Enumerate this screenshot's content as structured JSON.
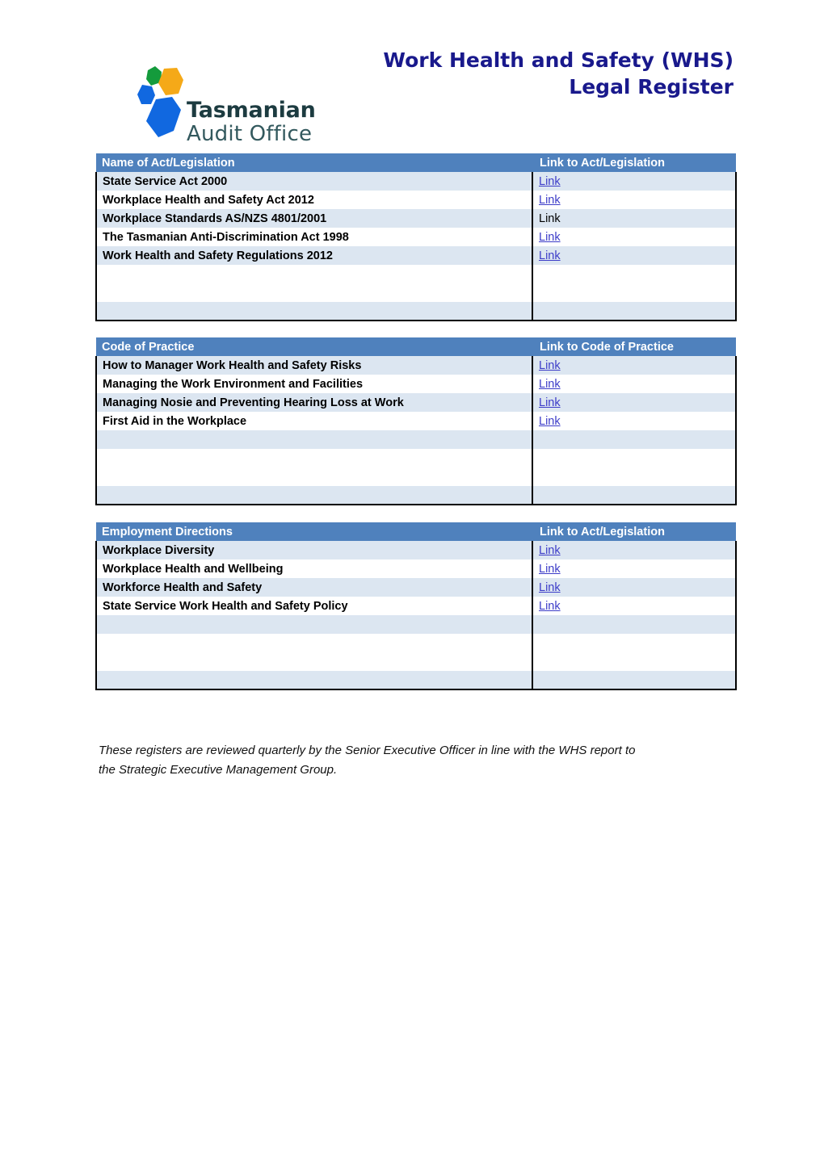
{
  "header": {
    "logo": {
      "line1": "Tasmanian",
      "line2": "Audit Office",
      "colors": {
        "green": "#149b3c",
        "orange": "#f5a918",
        "blue": "#1168e0",
        "wordmark_dark": "#1c3b40",
        "wordmark_light": "#33595e"
      }
    },
    "title_line1": "Work Health and Safety (WHS)",
    "title_line2": "Legal Register",
    "title_color": "#19198c"
  },
  "colors": {
    "table_header_bg": "#4f81bd",
    "table_header_text": "#ffffff",
    "row_shade": "#dce6f1",
    "row_plain": "#ffffff",
    "link": "#3c3cc8",
    "border": "#000000"
  },
  "tables": [
    {
      "id": "legislation",
      "headers": [
        "Name of Act/Legislation",
        "Link to Act/Legislation"
      ],
      "rows": [
        {
          "name": "State Service Act 2000",
          "link": "Link",
          "is_link": true
        },
        {
          "name": "Workplace Health and Safety Act 2012",
          "link": "Link",
          "is_link": true
        },
        {
          "name": "Workplace Standards AS/NZS 4801/2001",
          "link": "Link",
          "is_link": false
        },
        {
          "name": "The Tasmanian Anti-Discrimination Act 1998",
          "link": "Link",
          "is_link": true
        },
        {
          "name": "Work Health and Safety Regulations 2012",
          "link": "Link",
          "is_link": true
        },
        {
          "name": "",
          "link": "",
          "is_link": false
        },
        {
          "name": "",
          "link": "",
          "is_link": false
        },
        {
          "name": "",
          "link": "",
          "is_link": false
        }
      ]
    },
    {
      "id": "code-of-practice",
      "headers": [
        "Code of Practice",
        "Link to Code of Practice"
      ],
      "rows": [
        {
          "name": "How to Manager Work Health and Safety Risks",
          "link": "Link",
          "is_link": true
        },
        {
          "name": "Managing the Work Environment and Facilities",
          "link": "Link",
          "is_link": true
        },
        {
          "name": "Managing Nosie and Preventing Hearing Loss at Work",
          "link": "Link",
          "is_link": true
        },
        {
          "name": "First Aid in the Workplace",
          "link": "Link",
          "is_link": true
        },
        {
          "name": "",
          "link": "",
          "is_link": false
        },
        {
          "name": "",
          "link": "",
          "is_link": false
        },
        {
          "name": "",
          "link": "",
          "is_link": false
        },
        {
          "name": "",
          "link": "",
          "is_link": false
        }
      ]
    },
    {
      "id": "employment-directions",
      "headers": [
        "Employment Directions",
        "Link to Act/Legislation"
      ],
      "rows": [
        {
          "name": "Workplace Diversity",
          "link": "Link",
          "is_link": true
        },
        {
          "name": "Workplace Health and Wellbeing",
          "link": "Link",
          "is_link": true
        },
        {
          "name": "Workforce Health and Safety",
          "link": "Link",
          "is_link": true
        },
        {
          "name": "State Service Work Health and Safety Policy",
          "link": "Link",
          "is_link": true
        },
        {
          "name": "",
          "link": "",
          "is_link": false
        },
        {
          "name": "",
          "link": "",
          "is_link": false
        },
        {
          "name": "",
          "link": "",
          "is_link": false
        },
        {
          "name": "",
          "link": "",
          "is_link": false
        }
      ]
    }
  ],
  "note": {
    "line1": "These registers are reviewed quarterly by the Senior Executive Officer in line with the WHS report to",
    "line2": "the Strategic Executive Management Group."
  }
}
